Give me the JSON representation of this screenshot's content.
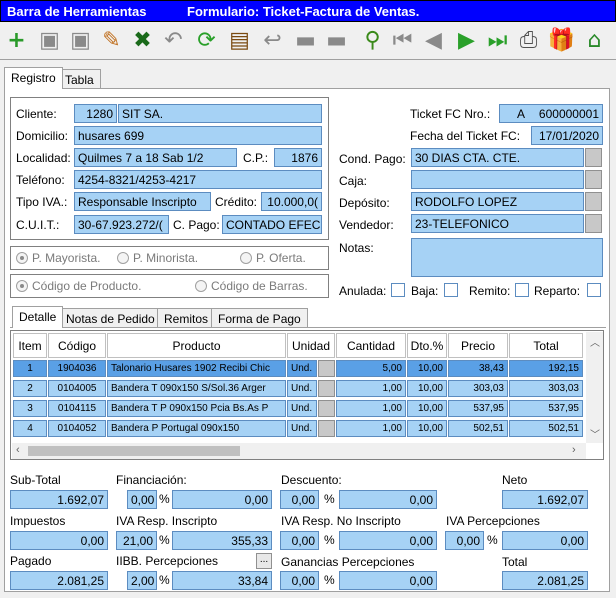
{
  "title": {
    "left": "Barra de Herramientas",
    "right": "Formulario: Ticket-Factura de Ventas."
  },
  "toolbar": {
    "icons": [
      "add-icon",
      "save-icon",
      "save-as-icon",
      "edit-icon",
      "delete-icon",
      "undo-icon",
      "refresh-icon",
      "film-icon",
      "back-icon",
      "grid-icon",
      "list-icon",
      "search-icon",
      "first-icon",
      "prev-icon",
      "next-icon",
      "last-icon",
      "print-icon",
      "gift-icon",
      "home-icon"
    ]
  },
  "tabs": {
    "registro": "Registro",
    "tabla": "Tabla"
  },
  "cliente": {
    "cliente_label": "Cliente:",
    "cliente_num": "1280",
    "cliente_name": "SIT SA.",
    "domicilio_label": "Domicilio:",
    "domicilio": "husares  699",
    "localidad_label": "Localidad:",
    "localidad": "Quilmes 7 a 18 Sab 1/2",
    "cp_label": "C.P.:",
    "cp": "1876",
    "telefono_label": "Teléfono:",
    "telefono": "4254-8321/4253-4217",
    "tipo_iva_label": "Tipo IVA.:",
    "tipo_iva": "Responsable Inscripto",
    "credito_label": "Crédito:",
    "credito": "10.000,0(",
    "cuit_label": "C.U.I.T.:",
    "cuit": "30-67.923.272/(",
    "cpago_label": "C. Pago:",
    "cpago": "CONTADO EFEC"
  },
  "ticket": {
    "nro_label": "Ticket FC Nro.:",
    "nro_letter": "A",
    "nro": "600000001",
    "fecha_label": "Fecha del Ticket FC:",
    "fecha": "17/01/2020",
    "cond_pago_label": "Cond. Pago:",
    "cond_pago": "30 DIAS CTA. CTE.",
    "caja_label": "Caja:",
    "caja": "",
    "deposito_label": "Depósito:",
    "deposito": "RODOLFO LOPEZ",
    "vendedor_label": "Vendedor:",
    "vendedor": "23-TELEFONICO",
    "notas_label": "Notas:"
  },
  "price_options": {
    "mayorista": "P. Mayorista.",
    "minorista": "P. Minorista.",
    "oferta": "P. Oferta."
  },
  "code_options": {
    "producto": "Código de Producto.",
    "barras": "Código de Barras."
  },
  "flags": {
    "anulada": "Anulada:",
    "baja": "Baja:",
    "remito": "Remito:",
    "reparto": "Reparto:"
  },
  "detail_tabs": {
    "detalle": "Detalle",
    "notas": "Notas de Pedido",
    "remitos": "Remitos",
    "forma": "Forma de Pago"
  },
  "grid": {
    "headers": {
      "item": "Item",
      "codigo": "Código",
      "producto": "Producto",
      "unidad": "Unidad",
      "cantidad": "Cantidad",
      "dto": "Dto.%",
      "precio": "Precio",
      "total": "Total"
    },
    "rows": [
      {
        "item": "1",
        "codigo": "1904036",
        "producto": "Talonario Husares 1902 Recibi Chic",
        "unidad": "Und.",
        "cantidad": "5,00",
        "dto": "10,00",
        "precio": "38,43",
        "total": "192,15"
      },
      {
        "item": "2",
        "codigo": "0104005",
        "producto": "Bandera T 090x150 S/Sol.36 Arger",
        "unidad": "Und.",
        "cantidad": "1,00",
        "dto": "10,00",
        "precio": "303,03",
        "total": "303,03"
      },
      {
        "item": "3",
        "codigo": "0104115",
        "producto": "Bandera T P 090x150 Pcia Bs.As P",
        "unidad": "Und.",
        "cantidad": "1,00",
        "dto": "10,00",
        "precio": "537,95",
        "total": "537,95"
      },
      {
        "item": "4",
        "codigo": "0104052",
        "producto": "Bandera P Portugal  090x150",
        "unidad": "Und.",
        "cantidad": "1,00",
        "dto": "10,00",
        "precio": "502,51",
        "total": "502,51"
      }
    ]
  },
  "totals": {
    "subtotal_label": "Sub-Total",
    "subtotal": "1.692,07",
    "financiacion_label": "Financiación:",
    "financiacion_pct": "0,00",
    "financiacion": "0,00",
    "descuento_label": "Descuento:",
    "descuento_pct": "0,00",
    "descuento": "0,00",
    "neto_label": "Neto",
    "neto": "1.692,07",
    "impuestos_label": "Impuestos",
    "impuestos": "0,00",
    "iva_ri_label": "IVA Resp. Inscripto",
    "iva_ri_pct": "21,00",
    "iva_ri": "355,33",
    "iva_rni_label": "IVA Resp. No Inscripto",
    "iva_rni_pct": "0,00",
    "iva_rni": "0,00",
    "iva_perc_label": "IVA Percepciones",
    "iva_perc_pct": "0,00",
    "iva_perc": "0,00",
    "pagado_label": "Pagado",
    "pagado": "2.081,25",
    "iibb_label": "IIBB. Percepciones",
    "iibb_pct": "2,00",
    "iibb": "33,84",
    "ganancias_label": "Ganancias Percepciones",
    "ganancias_pct": "0,00",
    "ganancias": "0,00",
    "total_label": "Total",
    "total": "2.081,25",
    "pct": "%",
    "ellipsis": "..."
  }
}
